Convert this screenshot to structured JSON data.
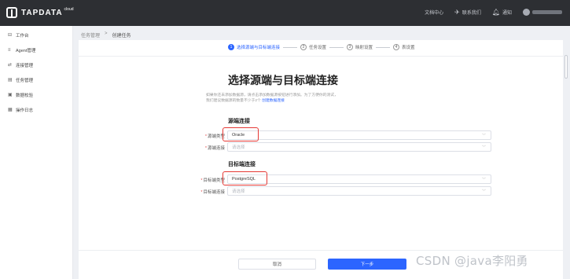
{
  "header": {
    "brand": "TAPDATA",
    "brand_sup": "cloud",
    "docs": "文档中心",
    "contact": "联系我们",
    "notifications": "通知"
  },
  "sidebar": {
    "items": [
      {
        "icon": "workbench-icon",
        "label": "工作台"
      },
      {
        "icon": "agent-icon",
        "label": "Agent管理"
      },
      {
        "icon": "connection-icon",
        "label": "连接管理"
      },
      {
        "icon": "task-icon",
        "label": "任务管理"
      },
      {
        "icon": "verify-icon",
        "label": "数据校验"
      },
      {
        "icon": "log-icon",
        "label": "操作日志"
      }
    ]
  },
  "breadcrumb": {
    "parent": "任务管理",
    "separator": ">",
    "current": "创建任务"
  },
  "steps": [
    {
      "num": "1",
      "label": "选择源端与目标端连接",
      "active": true
    },
    {
      "num": "2",
      "label": "任务设置",
      "active": false
    },
    {
      "num": "3",
      "label": "映射设置",
      "active": false
    },
    {
      "num": "4",
      "label": "表设置",
      "active": false
    }
  ],
  "page": {
    "title": "选择源端与目标端连接",
    "desc": "如果你还未添加数据源，请点击添加数据源按钮进行添加。为了方便你的测试，我们建议数据源的数量不少于2个",
    "desc_link": "创建数据连接"
  },
  "source": {
    "section_title": "源端连接",
    "type_label": "源端类型",
    "type_value": "Oracle",
    "conn_label": "源端连接",
    "conn_placeholder": "请选择"
  },
  "target": {
    "section_title": "目标端连接",
    "type_label": "目标端类型",
    "type_value": "PostgreSQL",
    "conn_label": "目标端连接",
    "conn_placeholder": "请选择"
  },
  "buttons": {
    "cancel": "取消",
    "next": "下一步"
  },
  "watermark": "CSDN @java李阳勇",
  "colors": {
    "accent": "#2c65ff",
    "highlight": "#e53935",
    "header_bg": "#2d2f33"
  }
}
